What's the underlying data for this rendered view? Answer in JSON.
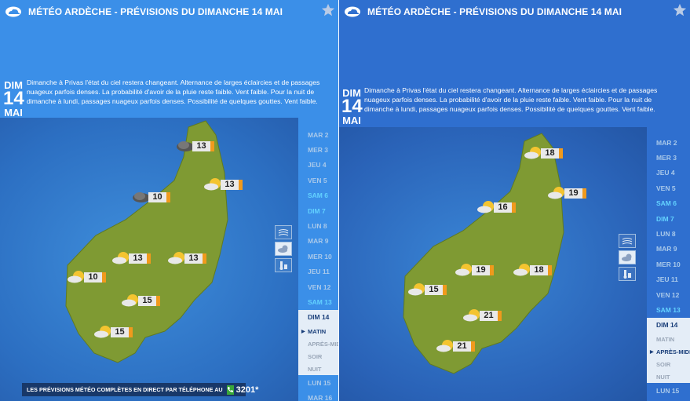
{
  "left": {
    "title": "MÉTÉO ARDÈCHE - PRÉVISIONS DU DIMANCHE 14 MAI",
    "day_abbr": "DIM",
    "day_num": "14",
    "month": "MAI",
    "description": "Dimanche à Privas l'état du ciel restera changeant. Alternance de larges éclaircies et de passages nuageux parfois denses. La probabilité d'avoir de la pluie reste faible. Vent faible. Pour la nuit de dimanche à lundi, passages nuageux parfois denses. Possibilité de quelques gouttes. Vent faible.",
    "forecasts": [
      {
        "temp": "13",
        "icon": "cloud-icon"
      },
      {
        "temp": "13",
        "icon": "sun-cloud-icon"
      },
      {
        "temp": "10",
        "icon": "cloud-icon"
      },
      {
        "temp": "13",
        "icon": "sun-cloud-icon"
      },
      {
        "temp": "13",
        "icon": "sun-cloud-icon"
      },
      {
        "temp": "10",
        "icon": "sun-cloud-icon"
      },
      {
        "temp": "15",
        "icon": "sun-cloud-icon"
      },
      {
        "temp": "15",
        "icon": "sun-cloud-icon"
      }
    ],
    "days": [
      {
        "label": "MAR 2"
      },
      {
        "label": "MER 3"
      },
      {
        "label": "JEU 4"
      },
      {
        "label": "VEN 5"
      },
      {
        "label": "SAM 6"
      },
      {
        "label": "DIM 7"
      },
      {
        "label": "LUN 8"
      },
      {
        "label": "MAR 9"
      },
      {
        "label": "MER 10"
      },
      {
        "label": "JEU 11"
      },
      {
        "label": "VEN 12"
      },
      {
        "label": "SAM 13"
      },
      {
        "label": "DIM 14"
      }
    ],
    "periods": [
      {
        "label": "MATIN"
      },
      {
        "label": "APRÈS-MIDI"
      },
      {
        "label": "SOIR"
      },
      {
        "label": "NUIT"
      }
    ],
    "days_after": [
      {
        "label": "LUN 15"
      },
      {
        "label": "MAR 16"
      }
    ],
    "active_period": 0,
    "phone_text": "LES PRÉVISIONS MÉTÉO COMPLÈTES EN DIRECT PAR TÉLÉPHONE AU",
    "phone_number": "3201*"
  },
  "right": {
    "title": "MÉTÉO ARDÈCHE - PRÉVISIONS DU DIMANCHE 14 MAI",
    "day_abbr": "DIM",
    "day_num": "14",
    "month": "MAI",
    "description": "Dimanche à Privas l'état du ciel restera changeant. Alternance de larges éclaircies et de passages nuageux parfois denses. La probabilité d'avoir de la pluie reste faible. Vent faible. Pour la nuit de dimanche à lundi, passages nuageux parfois denses. Possibilité de quelques gouttes. Vent faible.",
    "forecasts": [
      {
        "temp": "18",
        "icon": "sun-cloud-icon"
      },
      {
        "temp": "19",
        "icon": "sun-cloud-icon"
      },
      {
        "temp": "16",
        "icon": "sun-cloud-icon"
      },
      {
        "temp": "19",
        "icon": "sun-cloud-icon"
      },
      {
        "temp": "18",
        "icon": "sun-cloud-icon"
      },
      {
        "temp": "15",
        "icon": "sun-cloud-icon"
      },
      {
        "temp": "21",
        "icon": "sun-cloud-icon"
      },
      {
        "temp": "21",
        "icon": "sun-cloud-icon"
      }
    ],
    "days": [
      {
        "label": "MAR 2"
      },
      {
        "label": "MER 3"
      },
      {
        "label": "JEU 4"
      },
      {
        "label": "VEN 5"
      },
      {
        "label": "SAM 6"
      },
      {
        "label": "DIM 7"
      },
      {
        "label": "LUN 8"
      },
      {
        "label": "MAR 9"
      },
      {
        "label": "MER 10"
      },
      {
        "label": "JEU 11"
      },
      {
        "label": "VEN 12"
      },
      {
        "label": "SAM 13"
      },
      {
        "label": "DIM 14"
      }
    ],
    "periods": [
      {
        "label": "MATIN"
      },
      {
        "label": "APRÈS-MIDI"
      },
      {
        "label": "SOIR"
      },
      {
        "label": "NUIT"
      }
    ],
    "days_after": [
      {
        "label": "LUN 15"
      }
    ],
    "active_period": 1
  },
  "colors": {
    "map_green": "#7f9a33",
    "temp_accent": "#f09a1d",
    "weekend": "#63d2ff"
  }
}
